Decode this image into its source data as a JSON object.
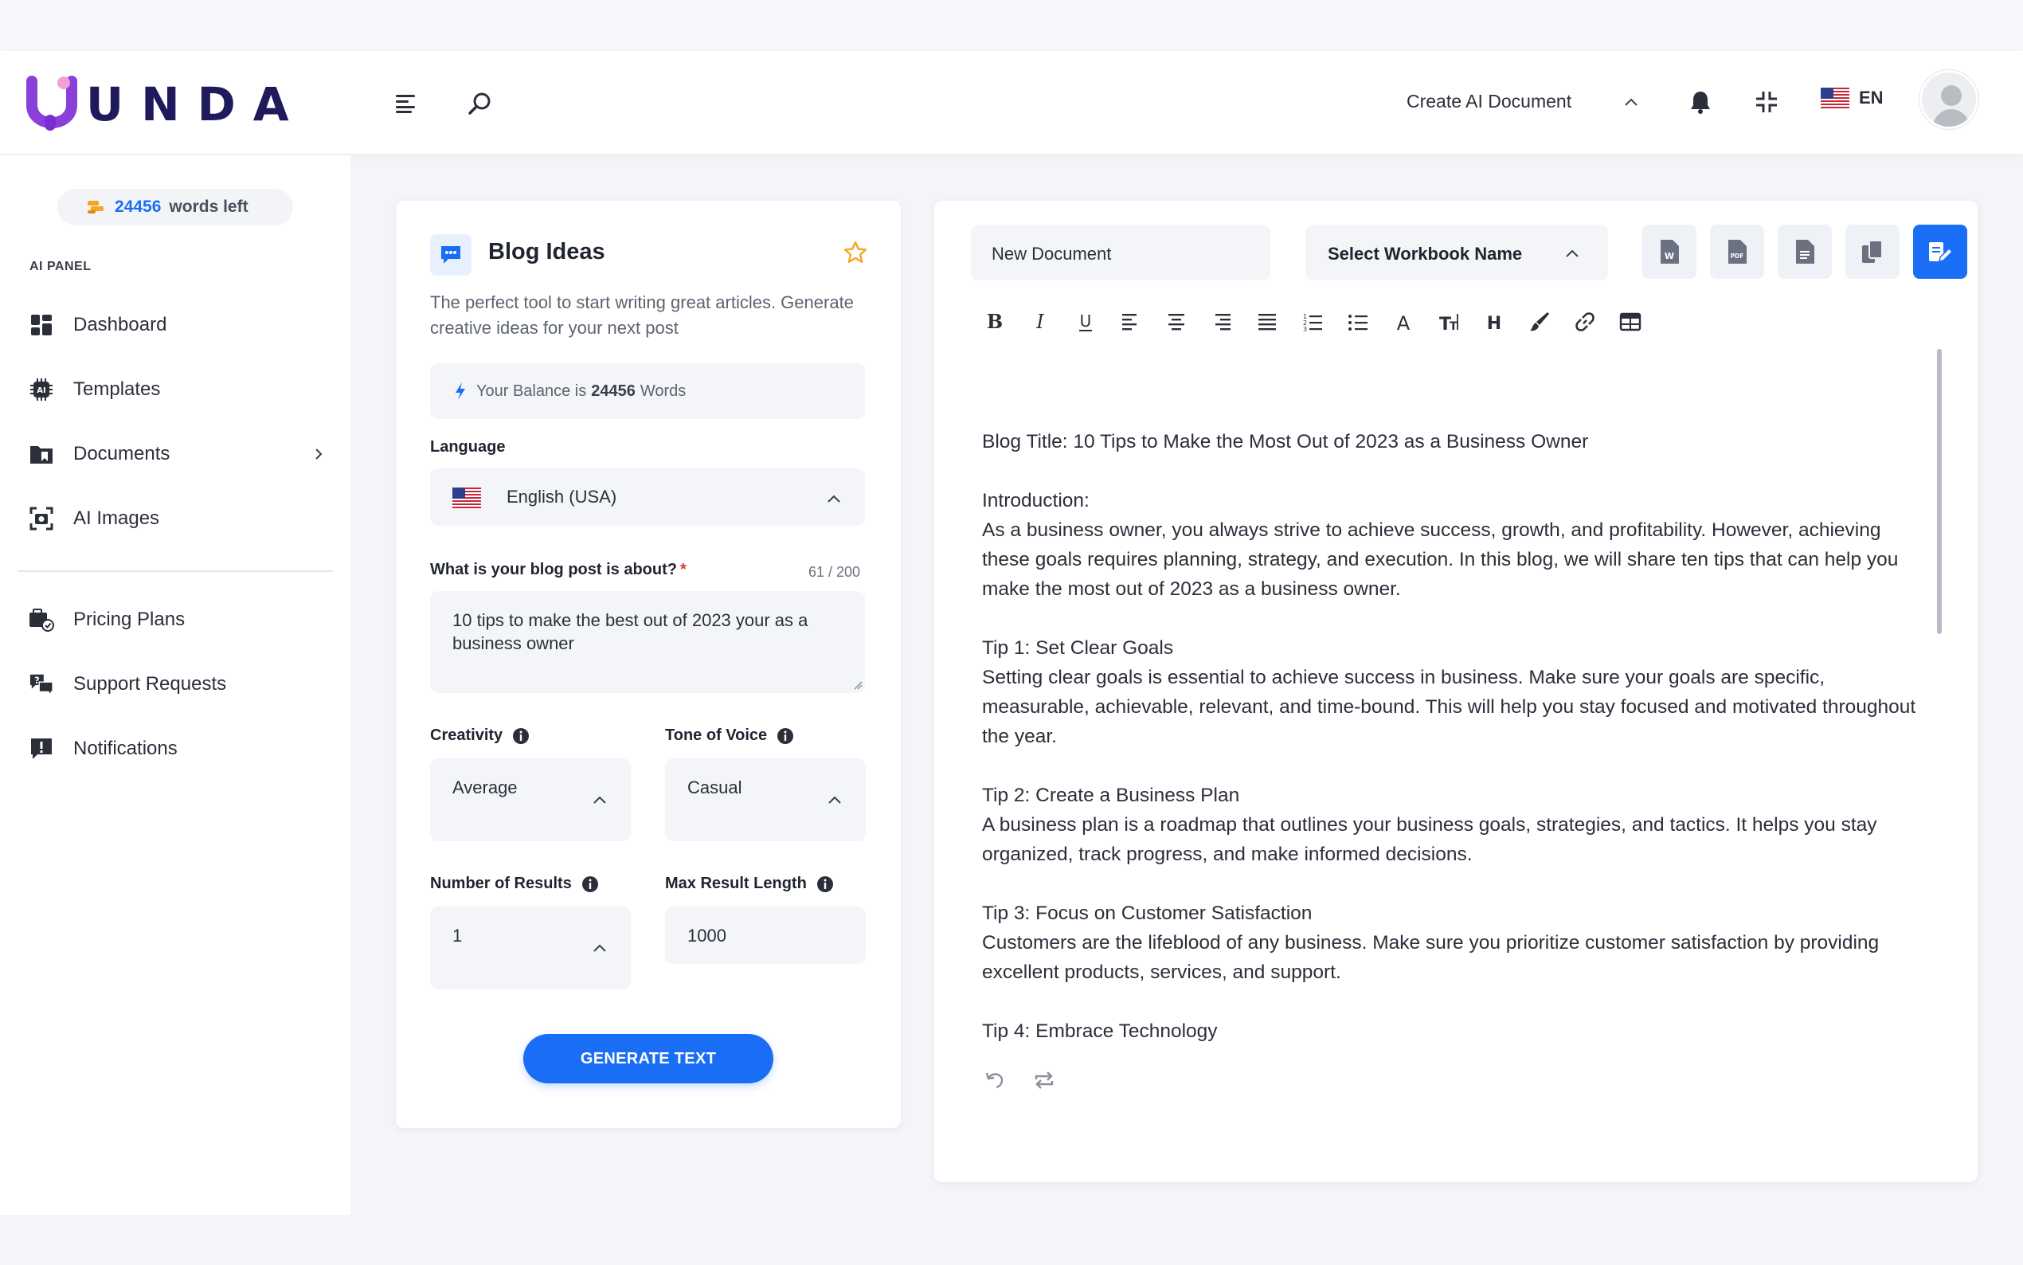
{
  "header": {
    "logo_text": "UNDA",
    "create_ai_label": "Create AI Document",
    "language_code": "EN"
  },
  "sidebar": {
    "words_left_count": "24456",
    "words_left_label": "words left",
    "panel_title": "AI PANEL",
    "items": [
      {
        "label": "Dashboard",
        "icon": "dashboard-icon"
      },
      {
        "label": "Templates",
        "icon": "ai-chip-icon"
      },
      {
        "label": "Documents",
        "icon": "folder-icon"
      },
      {
        "label": "AI Images",
        "icon": "camera-scan-icon"
      },
      {
        "label": "Pricing Plans",
        "icon": "pricing-icon"
      },
      {
        "label": "Support Requests",
        "icon": "support-icon"
      },
      {
        "label": "Notifications",
        "icon": "alert-message-icon"
      }
    ]
  },
  "tool": {
    "title": "Blog Ideas",
    "description": "The perfect tool to start writing great articles. Generate creative ideas for your next post",
    "balance_prefix": "Your Balance is",
    "balance_value": "24456",
    "balance_suffix": "Words",
    "language_label": "Language",
    "language_value": "English (USA)",
    "topic_label": "What is your blog post is about?",
    "topic_required_mark": "*",
    "topic_counter": "61 / 200",
    "topic_value": "10 tips to make the best out of 2023 your as a business owner",
    "creativity_label": "Creativity",
    "creativity_value": "Average",
    "tone_label": "Tone of Voice",
    "tone_value": "Casual",
    "results_label": "Number of Results",
    "results_value": "1",
    "max_length_label": "Max Result Length",
    "max_length_value": "1000",
    "generate_label": "GENERATE TEXT"
  },
  "editor": {
    "document_name": "New Document",
    "workbook_placeholder": "Select Workbook Name",
    "paragraphs": [
      "Blog Title: 10 Tips to Make the Most Out of 2023 as a Business Owner",
      "",
      "Introduction:",
      "As a business owner, you always strive to achieve success, growth, and profitability. However, achieving these goals requires planning, strategy, and execution. In this blog, we will share ten tips that can help you make the most out of 2023 as a business owner.",
      "",
      "Tip 1: Set Clear Goals",
      "Setting clear goals is essential to achieve success in business. Make sure your goals are specific, measurable, achievable, relevant, and time-bound. This will help you stay focused and motivated throughout the year.",
      "",
      "Tip 2: Create a Business Plan",
      "A business plan is a roadmap that outlines your business goals, strategies, and tactics. It helps you stay organized, track progress, and make informed decisions.",
      "",
      "Tip 3: Focus on Customer Satisfaction",
      "Customers are the lifeblood of any business. Make sure you prioritize customer satisfaction by providing excellent products, services, and support.",
      "",
      "Tip 4: Embrace Technology"
    ]
  },
  "colors": {
    "accent": "#1a6ef5",
    "logo_dark": "#1e1a5c",
    "logo_purple": "#8b3fd9",
    "star": "#f5a623"
  }
}
